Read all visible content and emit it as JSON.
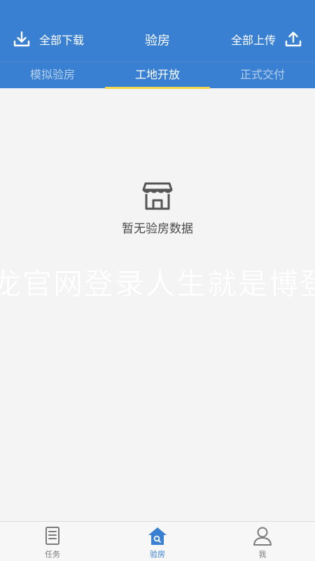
{
  "header": {
    "title": "验房",
    "download_all_label": "全部下载",
    "upload_all_label": "全部上传",
    "download_icon": "download-icon",
    "upload_icon": "upload-icon"
  },
  "tabs": [
    {
      "label": "模拟验房",
      "active": false
    },
    {
      "label": "工地开放",
      "active": true
    },
    {
      "label": "正式交付",
      "active": false
    }
  ],
  "empty_state": {
    "icon": "shop-icon",
    "text": "暂无验房数据"
  },
  "watermark": {
    "text": "龙官网登录人生就是博登"
  },
  "bottom_nav": [
    {
      "label": "任务",
      "icon": "document-icon",
      "active": false
    },
    {
      "label": "验房",
      "icon": "house-search-icon",
      "active": true
    },
    {
      "label": "我",
      "icon": "user-icon",
      "active": false
    }
  ],
  "colors": {
    "primary": "#3a80d2",
    "tab_indicator": "#f2d54a",
    "background": "#f4f4f4"
  }
}
